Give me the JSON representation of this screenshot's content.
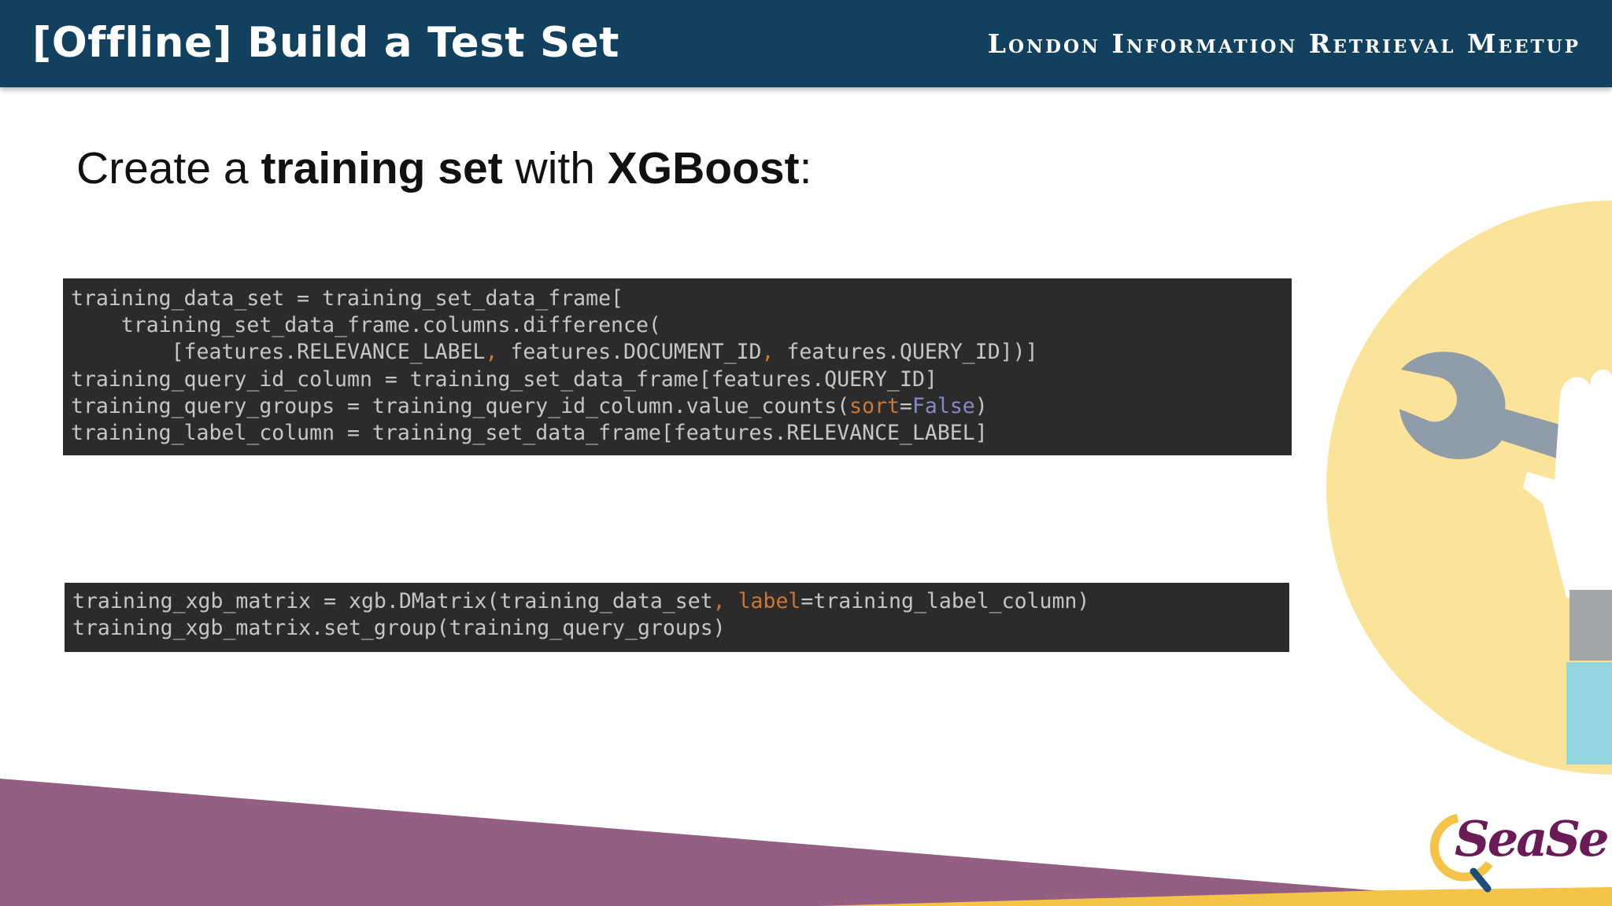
{
  "header": {
    "title": "[Offline] Build a Test Set",
    "subtitle": "London Information Retrieval Meetup"
  },
  "heading": {
    "part1": "Create a ",
    "bold1": "training set",
    "part2": " with ",
    "bold2": "XGBoost",
    "part3": ":"
  },
  "code_block_1": [
    {
      "text": "training_data_set = training_set_data_frame["
    },
    {
      "text": "    training_set_data_frame.columns.difference("
    },
    {
      "a": "        [features.RELEVANCE_LABEL",
      "comma1": ",",
      "b": " features.DOCUMENT_ID",
      "comma2": ",",
      "c": " features.QUERY_ID])]"
    },
    {
      "text": "training_query_id_column = training_set_data_frame[features.QUERY_ID]"
    },
    {
      "a": "training_query_groups = training_query_id_column.value_counts(",
      "kw": "sort",
      "eq": "=",
      "const": "False",
      "c": ")"
    },
    {
      "text": "training_label_column = training_set_data_frame[features.RELEVANCE_LABEL]"
    }
  ],
  "code_block_2": [
    {
      "a": "training_xgb_matrix = xgb.DMatrix(training_data_set",
      "comma": ",",
      "kw": " label",
      "c": "=training_label_column)"
    },
    {
      "text": "training_xgb_matrix.set_group(training_query_groups)"
    }
  ],
  "logo": {
    "text": "SeaSe"
  },
  "colors": {
    "header_bg": "#124160",
    "code_bg": "#2b2b2b",
    "code_fg": "#c6c6c6",
    "keyword": "#cc7832",
    "constant": "#8888c6",
    "circle": "#fbe39a",
    "purple": "#955e83",
    "gold": "#f5c346",
    "logo": "#6b1a58"
  },
  "icons": [
    "wrench-icon",
    "hand-illustration",
    "magnifier-logo-icon"
  ]
}
